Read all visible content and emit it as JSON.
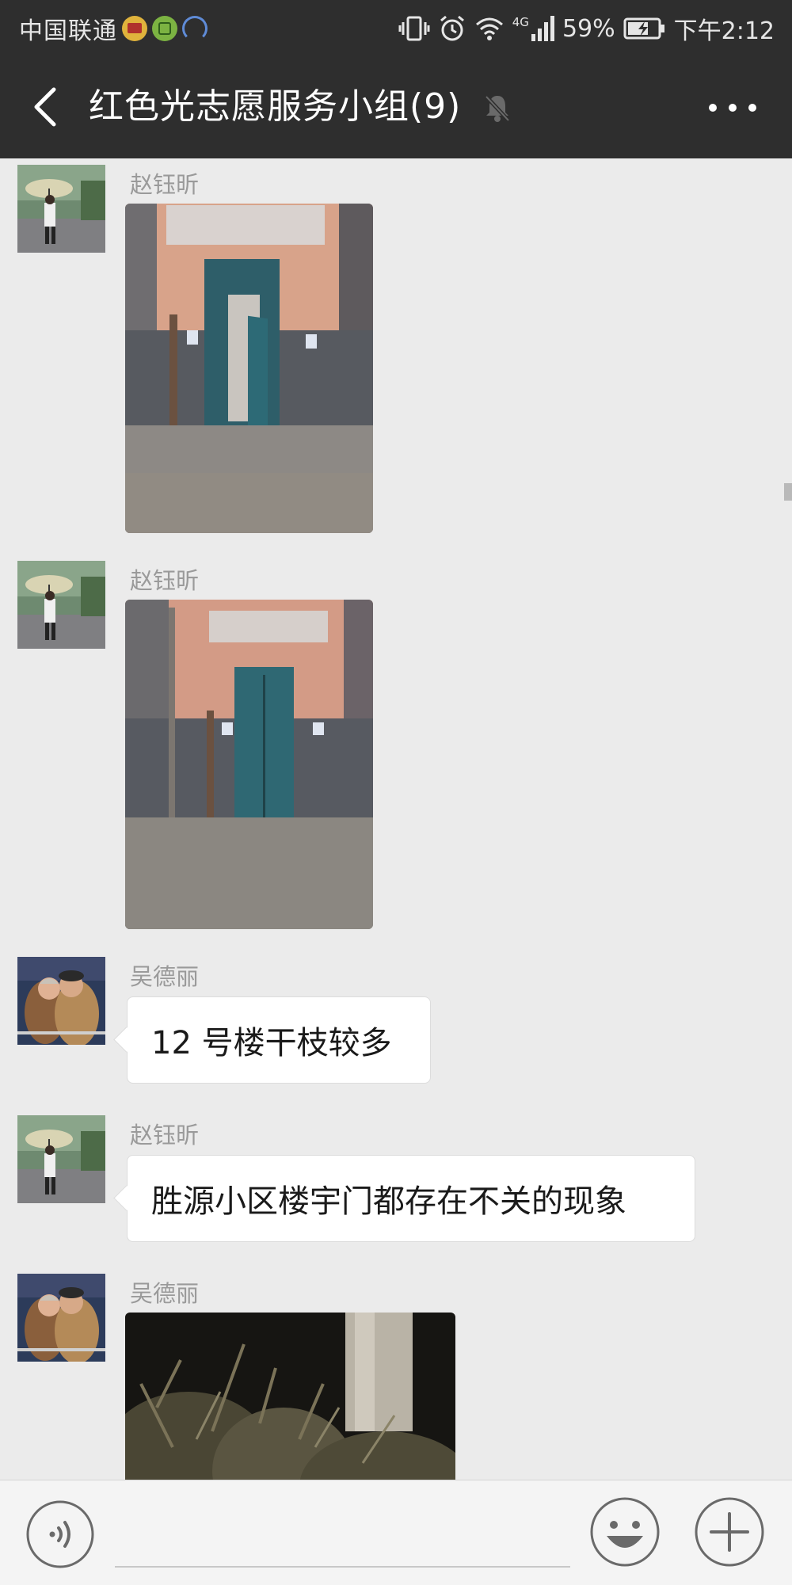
{
  "status_bar": {
    "carrier": "中国联通",
    "network": "4G",
    "battery_percent": "59%",
    "time": "下午2:12"
  },
  "chat": {
    "title": "红色光志愿服务小组(9)",
    "muted": true
  },
  "messages": [
    {
      "type": "image",
      "sender": "赵钰昕",
      "avatar": "man-with-umbrella",
      "image": "building-entrance-open-door-night"
    },
    {
      "type": "image",
      "sender": "赵钰昕",
      "avatar": "man-with-umbrella",
      "image": "building-entrance-night"
    },
    {
      "type": "text",
      "sender": "吴德丽",
      "avatar": "elderly-couple",
      "text": "12 号楼干枝较多"
    },
    {
      "type": "text",
      "sender": "赵钰昕",
      "avatar": "man-with-umbrella",
      "text": "胜源小区楼宇门都存在不关的现象"
    },
    {
      "type": "image",
      "sender": "吴德丽",
      "avatar": "elderly-couple",
      "image": "dry-branches-by-pole-night"
    }
  ],
  "colors": {
    "header_bg": "#2e2e2e",
    "chat_bg": "#ebebeb",
    "bubble_bg": "#ffffff",
    "sender_text": "#9a9a9a"
  },
  "icons": {
    "back": "back-chevron-icon",
    "mute": "bell-muted-icon",
    "more": "more-dots-icon",
    "voice": "voice-input-icon",
    "emoji": "emoji-icon",
    "plus": "plus-icon"
  }
}
